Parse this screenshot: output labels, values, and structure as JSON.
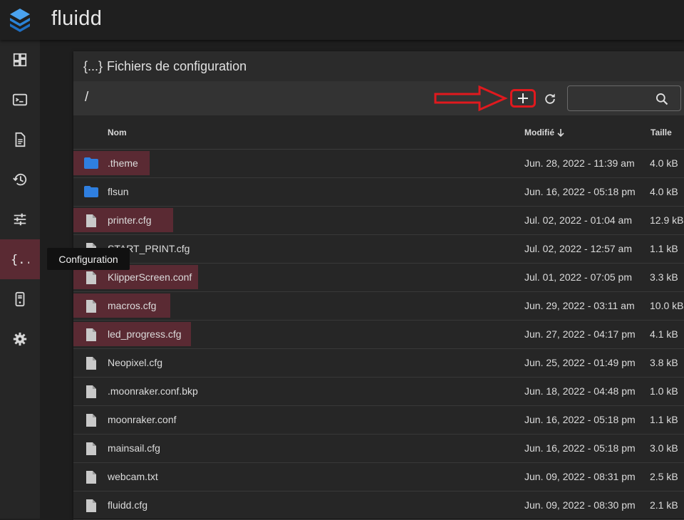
{
  "app": {
    "title": "fluidd"
  },
  "nav": {
    "items": [
      {
        "id": "dashboard",
        "icon": "dashboard-icon"
      },
      {
        "id": "console",
        "icon": "console-icon"
      },
      {
        "id": "jobs",
        "icon": "file-document-icon"
      },
      {
        "id": "history",
        "icon": "history-icon"
      },
      {
        "id": "tune",
        "icon": "tune-icon"
      },
      {
        "id": "configuration",
        "icon": "code-braces-icon",
        "active": true
      },
      {
        "id": "system",
        "icon": "server-icon"
      },
      {
        "id": "settings",
        "icon": "gear-icon"
      }
    ],
    "tooltip": "Configuration"
  },
  "card": {
    "braces": "{...}",
    "title": "Fichiers de configuration",
    "path": "/",
    "search": {
      "value": "",
      "placeholder": ""
    }
  },
  "table": {
    "columns": {
      "name": "Nom",
      "modified": "Modifié",
      "size": "Taille"
    },
    "rows": [
      {
        "type": "folder",
        "name": ".theme",
        "modified": "Jun. 28, 2022 - 11:39 am",
        "size": "4.0 kB",
        "highlight": true
      },
      {
        "type": "folder",
        "name": "flsun",
        "modified": "Jun. 16, 2022 - 05:18 pm",
        "size": "4.0 kB",
        "highlight": false
      },
      {
        "type": "file",
        "name": "printer.cfg",
        "modified": "Jul. 02, 2022 - 01:04 am",
        "size": "12.9 kB",
        "highlight": true
      },
      {
        "type": "file",
        "name": "START_PRINT.cfg",
        "modified": "Jul. 02, 2022 - 12:57 am",
        "size": "1.1 kB",
        "highlight": false
      },
      {
        "type": "file",
        "name": "KlipperScreen.conf",
        "modified": "Jul. 01, 2022 - 07:05 pm",
        "size": "3.3 kB",
        "highlight": true
      },
      {
        "type": "file",
        "name": "macros.cfg",
        "modified": "Jun. 29, 2022 - 03:11 am",
        "size": "10.0 kB",
        "highlight": true
      },
      {
        "type": "file",
        "name": "led_progress.cfg",
        "modified": "Jun. 27, 2022 - 04:17 pm",
        "size": "4.1 kB",
        "highlight": true
      },
      {
        "type": "file",
        "name": "Neopixel.cfg",
        "modified": "Jun. 25, 2022 - 01:49 pm",
        "size": "3.8 kB",
        "highlight": false
      },
      {
        "type": "file",
        "name": ".moonraker.conf.bkp",
        "modified": "Jun. 18, 2022 - 04:48 pm",
        "size": "1.0 kB",
        "highlight": false
      },
      {
        "type": "file",
        "name": "moonraker.conf",
        "modified": "Jun. 16, 2022 - 05:18 pm",
        "size": "1.1 kB",
        "highlight": false
      },
      {
        "type": "file",
        "name": "mainsail.cfg",
        "modified": "Jun. 16, 2022 - 05:18 pm",
        "size": "3.0 kB",
        "highlight": false
      },
      {
        "type": "file",
        "name": "webcam.txt",
        "modified": "Jun. 09, 2022 - 08:31 pm",
        "size": "2.5 kB",
        "highlight": false
      },
      {
        "type": "file",
        "name": "fluidd.cfg",
        "modified": "Jun. 09, 2022 - 08:30 pm",
        "size": "2.1 kB",
        "highlight": false
      }
    ]
  },
  "colors": {
    "accent": "#5a2a33",
    "folder": "#2f7fe0",
    "file": "#c9c9c9",
    "annotation": "#e0191e"
  }
}
